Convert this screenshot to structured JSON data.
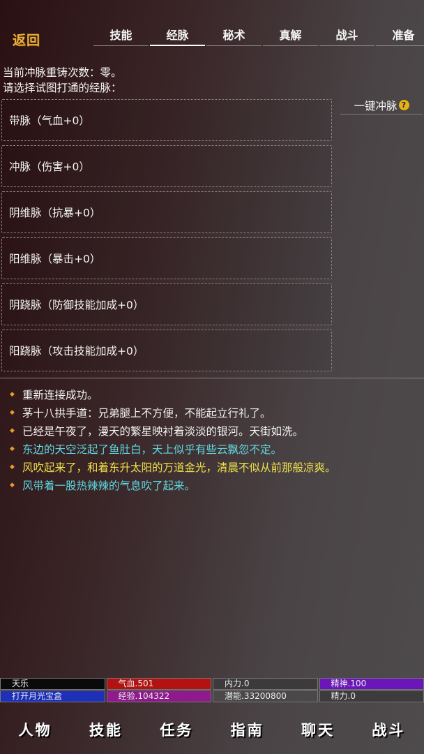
{
  "header": {
    "back_label": "返回",
    "tabs": [
      {
        "label": "技能",
        "active": false
      },
      {
        "label": "经脉",
        "active": true
      },
      {
        "label": "秘术",
        "active": false
      },
      {
        "label": "真解",
        "active": false
      },
      {
        "label": "战斗",
        "active": false
      },
      {
        "label": "准备",
        "active": false
      }
    ]
  },
  "info": {
    "recast_count": "当前冲脉重铸次数：零。",
    "prompt": "请选择试图打通的经脉："
  },
  "meridians": [
    {
      "label": "带脉（气血+0）"
    },
    {
      "label": "冲脉（伤害+0）"
    },
    {
      "label": "阴维脉（抗暴+0）"
    },
    {
      "label": "阳维脉（暴击+0）"
    },
    {
      "label": "阴跷脉（防御技能加成+0）"
    },
    {
      "label": "阳跷脉（攻击技能加成+0）"
    }
  ],
  "one_key": {
    "label": "一键冲脉",
    "icon": "question-icon",
    "icon_glyph": "?"
  },
  "messages": [
    {
      "text": "重新连接成功。",
      "color": "#f2f2f2"
    },
    {
      "text": "茅十八拱手道：兄弟腿上不方便，不能起立行礼了。",
      "color": "#f2f2f2"
    },
    {
      "text": "已经是午夜了，漫天的繁星映衬着淡淡的银河。天街如洗。",
      "color": "#f2f2f2"
    },
    {
      "text": "东边的天空泛起了鱼肚白，天上似乎有些云飘忽不定。",
      "color": "#5fd8e0"
    },
    {
      "text": "风吹起来了，和着东升太阳的万道金光，清晨不似从前那般凉爽。",
      "color": "#f0e04a"
    },
    {
      "text": "风带着一股热辣辣的气息吹了起来。",
      "color": "#5fd8e0"
    }
  ],
  "stats": [
    [
      {
        "label": "天乐",
        "bg": "#0a0a0a"
      },
      {
        "label": "气血.501",
        "bg": "#b31212"
      },
      {
        "label": "内力.0",
        "bg": "#3c3a3b"
      },
      {
        "label": "精神.100",
        "bg": "#6a16b8"
      }
    ],
    [
      {
        "label": "打开月光宝盒",
        "bg": "#1e2fb8"
      },
      {
        "label": "经验.104322",
        "bg": "#8e1a8c"
      },
      {
        "label": "潜能.33200800",
        "bg": "#4a4849"
      },
      {
        "label": "精力.0",
        "bg": "#3d3b3c"
      }
    ]
  ],
  "bottom_nav": [
    {
      "label": "人物"
    },
    {
      "label": "技能"
    },
    {
      "label": "任务"
    },
    {
      "label": "指南"
    },
    {
      "label": "聊天"
    },
    {
      "label": "战斗"
    }
  ]
}
